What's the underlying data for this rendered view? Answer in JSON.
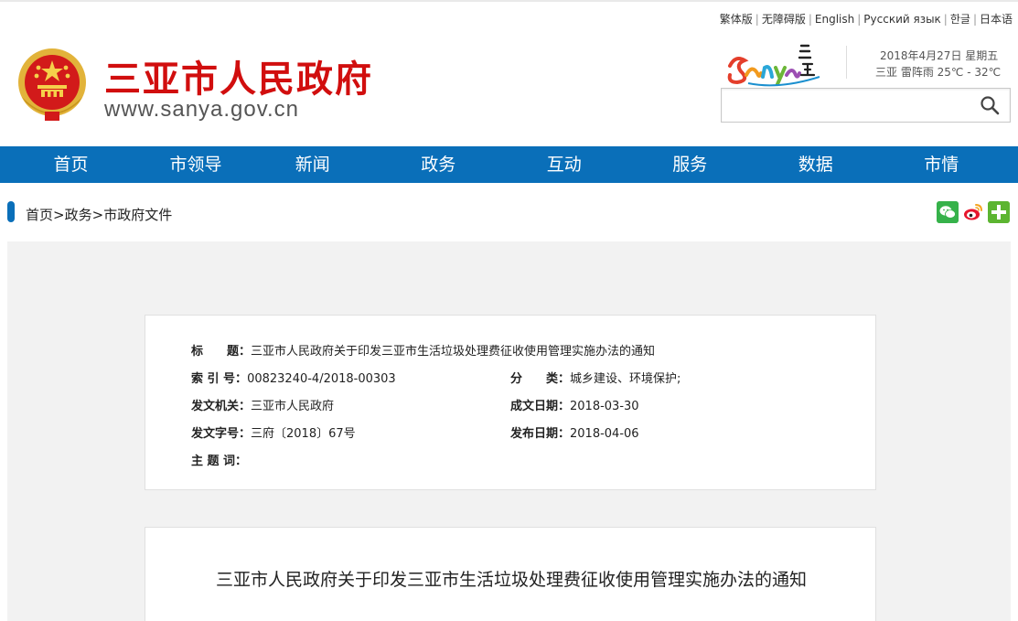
{
  "languages": [
    "繁体版",
    "无障碍版",
    "English",
    "Русский язык",
    "한글",
    "日本语"
  ],
  "header": {
    "title": "三亚市人民政府",
    "url": "www.sanya.gov.cn",
    "date": "2018年4月27日 星期五",
    "weather": "三亚 雷阵雨 25℃ - 32℃",
    "search": {
      "value": "",
      "placeholder": ""
    }
  },
  "nav": [
    "首页",
    "市领导",
    "新闻",
    "政务",
    "互动",
    "服务",
    "数据",
    "市情"
  ],
  "breadcrumb": {
    "items": [
      "首页",
      "政务",
      "市政府文件"
    ],
    "separator": ">"
  },
  "meta": {
    "title_label": "标　　题：",
    "title_value": "三亚市人民政府关于印发三亚市生活垃圾处理费征收使用管理实施办法的通知",
    "index_label": "索 引 号：",
    "index_value": "00823240-4/2018-00303",
    "category_label": "分　　类：",
    "category_value": "城乡建设、环境保护;",
    "issuer_label": "发文机关：",
    "issuer_value": "三亚市人民政府",
    "created_label": "成文日期：",
    "created_value": "2018-03-30",
    "docno_label": "发文字号：",
    "docno_value": "三府〔2018〕67号",
    "published_label": "发布日期：",
    "published_value": "2018-04-06",
    "keywords_label": "主 题 词：",
    "keywords_value": ""
  },
  "article": {
    "title": "三亚市人民政府关于印发三亚市生活垃圾处理费征收使用管理实施办法的通知"
  },
  "colors": {
    "brand_red": "#d10e0e",
    "nav_blue": "#0a6fb9"
  },
  "icons": [
    "search-icon",
    "wechat-icon",
    "weibo-icon",
    "plus-icon",
    "national-emblem",
    "sanya-logo"
  ]
}
